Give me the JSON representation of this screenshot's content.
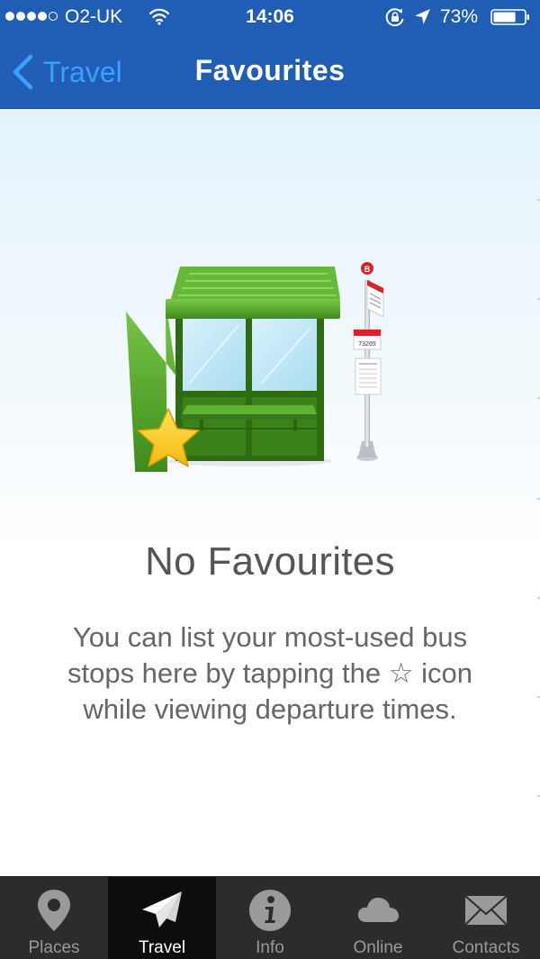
{
  "status_bar": {
    "carrier": "O2-UK",
    "time": "14:06",
    "battery_percent": "73%",
    "battery_level": 0.73,
    "signal_bars_filled": 4,
    "signal_bars_total": 5,
    "icons": [
      "wifi-icon",
      "rotation-lock-icon",
      "location-arrow-icon",
      "battery-icon"
    ]
  },
  "nav": {
    "back_label": "Travel",
    "title": "Favourites"
  },
  "empty_state": {
    "title": "No Favourites",
    "message_part1": "You can list your most-used bus stops here by tapping the",
    "star_glyph": "☆",
    "message_part2": "icon while viewing departure times.",
    "illustration": {
      "bus_stop_number": "73265",
      "bus_sign_letter": "B",
      "icons": [
        "bus-shelter-icon",
        "bus-stop-pole-icon",
        "favourite-star-icon"
      ]
    }
  },
  "tab_bar": {
    "tabs": [
      {
        "label": "Places",
        "icon": "map-pin-icon",
        "active": false
      },
      {
        "label": "Travel",
        "icon": "paper-plane-icon",
        "active": true
      },
      {
        "label": "Info",
        "icon": "info-icon",
        "active": false
      },
      {
        "label": "Online",
        "icon": "cloud-icon",
        "active": false
      },
      {
        "label": "Contacts",
        "icon": "envelope-icon",
        "active": false
      }
    ]
  },
  "colors": {
    "header_blue": "#1f5eb4",
    "back_link_blue": "#3aa1ff",
    "tab_bar_bg": "#2c2c2c",
    "tab_active_bg": "#0d0d0d",
    "shelter_green": "#4c9a23",
    "star_yellow": "#f6c517"
  }
}
